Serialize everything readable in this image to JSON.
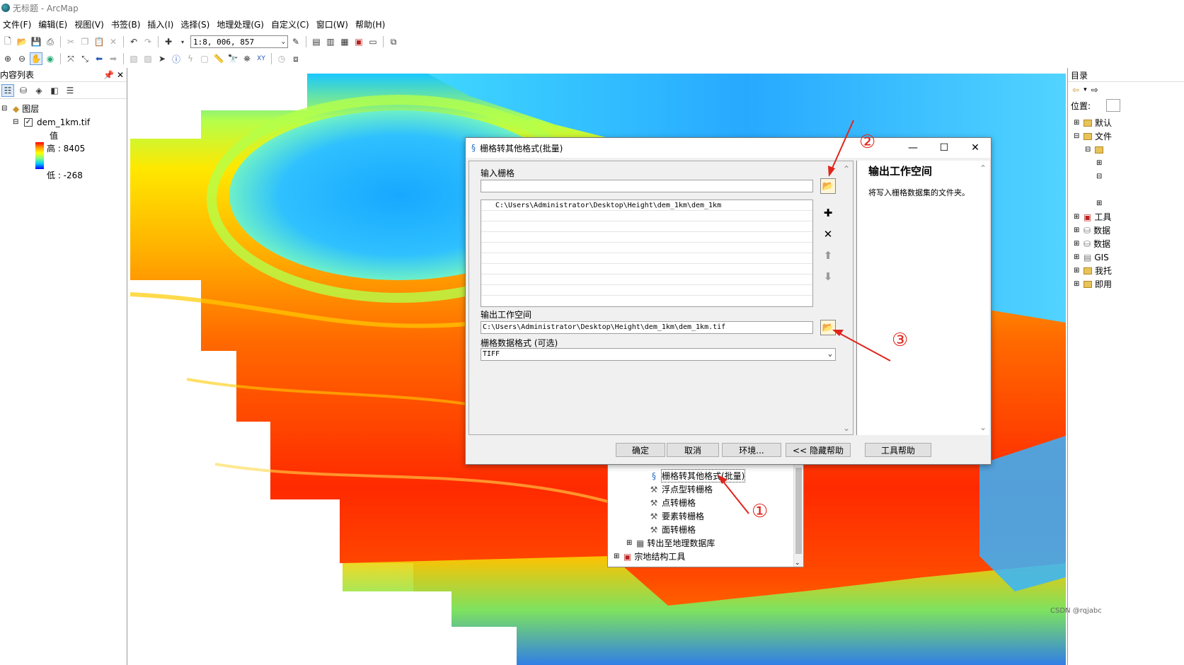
{
  "window": {
    "title": "无标题 - ArcMap"
  },
  "menu": [
    "文件(F)",
    "编辑(E)",
    "视图(V)",
    "书签(B)",
    "插入(I)",
    "选择(S)",
    "地理处理(G)",
    "自定义(C)",
    "窗口(W)",
    "帮助(H)"
  ],
  "toolbar": {
    "scale": "1:8, 006, 857"
  },
  "toc": {
    "title": "内容列表",
    "root": "图层",
    "layer": "dem_1km.tif",
    "legend_heading": "值",
    "high": "高 : 8405",
    "low": "低 : -268"
  },
  "catalog": {
    "title": "目录",
    "location_label": "位置:",
    "items": [
      "默认",
      "文件",
      "工具",
      "数据",
      "数据",
      "GIS",
      "我托",
      "即用"
    ]
  },
  "toolbox": {
    "items": [
      "栅格转其他格式(批量)",
      "浮点型转栅格",
      "点转栅格",
      "要素转栅格",
      "面转栅格",
      "转出至地理数据库",
      "宗地结构工具"
    ]
  },
  "dialog": {
    "title": "栅格转其他格式(批量)",
    "input_label": "输入栅格",
    "input_value": "",
    "input_list": [
      "C:\\Users\\Administrator\\Desktop\\Height\\dem_1km\\dem_1km"
    ],
    "output_label": "输出工作空间",
    "output_value": "C:\\Users\\Administrator\\Desktop\\Height\\dem_1km\\dem_1km.tif",
    "format_label": "栅格数据格式 (可选)",
    "format_value": "TIFF",
    "buttons": {
      "ok": "确定",
      "cancel": "取消",
      "env": "环境...",
      "hide_help": "<< 隐藏帮助",
      "tool_help": "工具帮助"
    },
    "help": {
      "title": "输出工作空间",
      "body": "将写入栅格数据集的文件夹。"
    }
  },
  "annotations": [
    "①",
    "②",
    "③"
  ],
  "watermark": "CSDN @rqjabc",
  "colors": {
    "accent": "#e0241b",
    "high": "#ff0000",
    "low": "#0000ff"
  }
}
